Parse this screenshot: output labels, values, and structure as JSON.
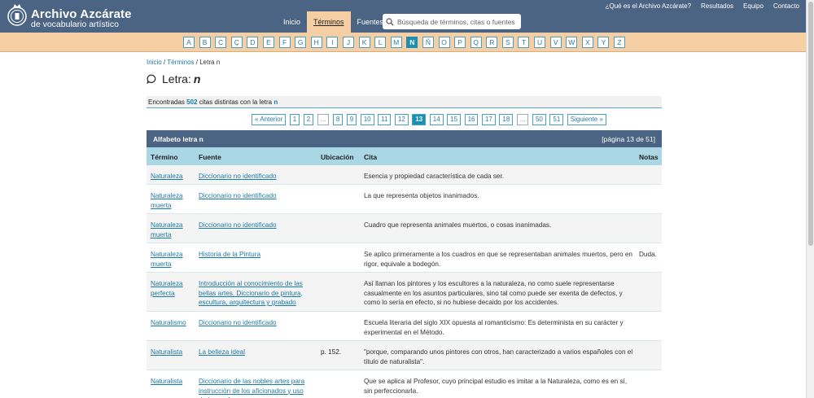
{
  "brand": {
    "title": "Archivo Azcárate",
    "subtitle": "de vocabulario artístico"
  },
  "nav": [
    {
      "label": "Inicio",
      "active": false
    },
    {
      "label": "Términos",
      "active": true
    },
    {
      "label": "Fuentes",
      "active": false
    }
  ],
  "search": {
    "placeholder": "Búsqueda de términos, citas o fuentes"
  },
  "topnav": [
    "¿Qué es el Archivo Azcárate?",
    "Resultados",
    "Equipo",
    "Contacto"
  ],
  "alphabet": {
    "letters": [
      "A",
      "B",
      "C",
      "Ç",
      "D",
      "E",
      "F",
      "G",
      "H",
      "I",
      "J",
      "K",
      "L",
      "M",
      "N",
      "Ñ",
      "O",
      "P",
      "Q",
      "R",
      "S",
      "T",
      "U",
      "V",
      "W",
      "X",
      "Y",
      "Z"
    ],
    "active": "N"
  },
  "breadcrumb": {
    "home": "Inicio",
    "terms": "Términos",
    "current": "Letra n"
  },
  "heading": {
    "prefix": "Letra:",
    "letter": "n"
  },
  "summary": {
    "text_before": "Encontradas",
    "count": "502",
    "text_middle": "citas distintas con la letra",
    "letter": "n"
  },
  "pagination": [
    "« Anterior",
    "1",
    "2",
    "...",
    "8",
    "9",
    "10",
    "11",
    "12",
    "13",
    "14",
    "15",
    "16",
    "17",
    "18",
    "...",
    "50",
    "51",
    "Siguiente »"
  ],
  "pagination_active": "13",
  "table": {
    "title": "Alfabeto letra n",
    "page_info": "[página 13 de 51]",
    "columns": {
      "term": "Término",
      "source": "Fuente",
      "location": "Ubicación",
      "quote": "Cita",
      "notes": "Notas"
    },
    "rows": [
      {
        "term": "Naturaleza",
        "source": "Diccionario no identificado",
        "location": "",
        "quote": "Esencia y propiedad característica de cada ser.",
        "notes": ""
      },
      {
        "term": "Naturaleza muerta",
        "source": "Diccionario no identificado",
        "location": "",
        "quote": "La que representa objetos inanimados.",
        "notes": ""
      },
      {
        "term": "Naturaleza muerta",
        "source": "Diccionario no identificado",
        "location": "",
        "quote": "Cuadro que representa animales muertos, o cosas inanimadas.",
        "notes": ""
      },
      {
        "term": "Naturaleza muerta",
        "source": "Historia de la Pintura",
        "location": "",
        "quote": "Se aplico primeramente a los cuadros en que se representaban animales muertos, pero en rigor, equivale a bodegón.",
        "notes": "Duda."
      },
      {
        "term": "Naturaleza perfecta",
        "source": "Introducción al conocimiento de las bellas artes. Diccionario de pintura, escultura, arquitectura y grabado",
        "location": "",
        "quote": "Así llaman los pintores y los escultores a la naturaleza, no como suele representarse casualmente en los asuntos particulares, sino tal como puede ser exenta de defectos, y como lo sería en efecto, si no hubiese decaido por los accidentes.",
        "notes": ""
      },
      {
        "term": "Naturalismo",
        "source": "Diccionario no identificado",
        "location": "",
        "quote": "Escuela literaria del siglo XIX opuesta al romanticismo: Es determinista en su carácter y experimental en el Método.",
        "notes": ""
      },
      {
        "term": "Naturalista",
        "source": "La belleza ideal",
        "location": "p. 152.",
        "quote": "\"porque, comparando unos pintores con otros, han caracterizado a varios españoles con el título de naturalista\".",
        "notes": ""
      },
      {
        "term": "Naturalista",
        "source": "Diccionario de las nobles artes para instrucción de los aficionados y uso de los profesores",
        "location": "",
        "quote": "Que se aplica al Profesor, cuyo principal estudio es imitar a la Naturaleza, como es en sí, sin perfeccionarla.",
        "notes": ""
      }
    ]
  },
  "colors": {
    "header": "#4c6483",
    "alphabar": "#f5cfa3",
    "accent": "#1c8fb5",
    "table_header": "#a9d7e4"
  }
}
